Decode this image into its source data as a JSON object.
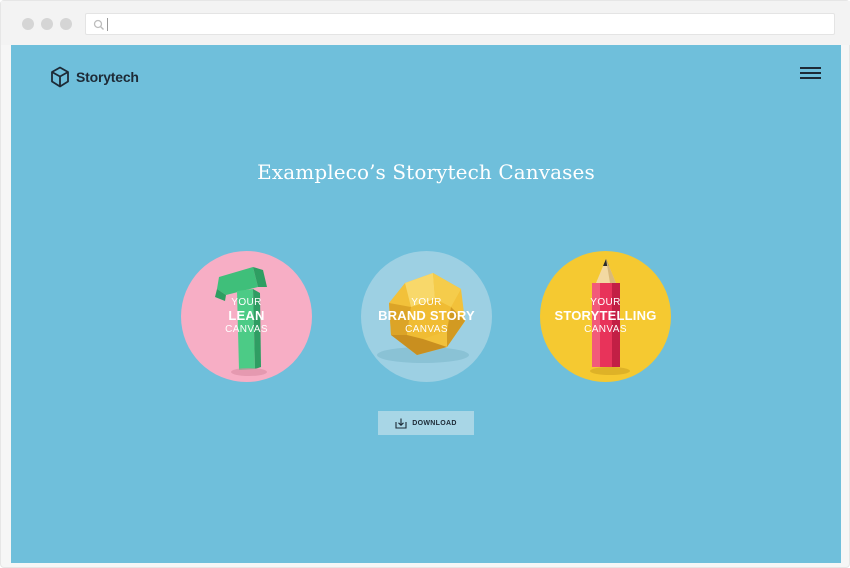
{
  "browser": {
    "url": ""
  },
  "header": {
    "brand": "Storytech"
  },
  "main": {
    "title": "Exampleco’s Storytech Canvases",
    "canvases": [
      {
        "line1": "Your",
        "line2": "Lean",
        "line3": "Canvas",
        "color": "#f7aec5"
      },
      {
        "line1": "Your",
        "line2": "Brand Story",
        "line3": "Canvas",
        "color": "#9dd0e3"
      },
      {
        "line1": "Your",
        "line2": "Storytelling",
        "line3": "Canvas",
        "color": "#f5c931"
      }
    ],
    "download_label": "DOWNLOAD"
  },
  "colors": {
    "page_background": "#6fbfdb",
    "brand_text": "#1d2a36"
  },
  "icons": {
    "logo": "cube-icon",
    "menu": "hamburger-menu-icon",
    "download": "download-tray-icon",
    "search": "search-icon"
  }
}
